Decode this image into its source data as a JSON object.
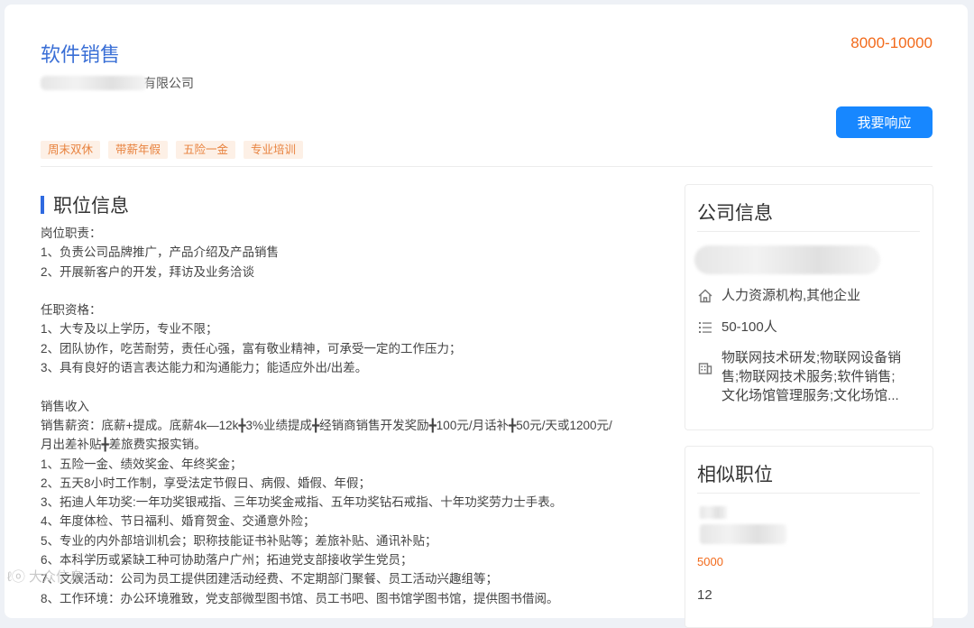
{
  "job": {
    "title": "软件销售",
    "company_suffix": "有限公司",
    "salary": "8000-10000",
    "respond_label": "我要响应",
    "tags": [
      "周末双休",
      "带薪年假",
      "五险一金",
      "专业培训"
    ]
  },
  "section": {
    "title": "职位信息",
    "lines": [
      "岗位职责：",
      "1、负责公司品牌推广，产品介绍及产品销售",
      "2、开展新客户的开发，拜访及业务洽谈",
      "",
      "任职资格：",
      "1、大专及以上学历，专业不限；",
      "2、团队协作，吃苦耐劳，责任心强，富有敬业精神，可承受一定的工作压力；",
      "3、具有良好的语言表达能力和沟通能力；能适应外出/出差。",
      "",
      "销售收入",
      "销售薪资：底薪+提成。底薪4k—12k╋3%业绩提成╋经销商销售开发奖励╋100元/月话补╋50元/天或1200元/",
      "月出差补贴╋差旅费实报实销。",
      "1、五险一金、绩效奖金、年终奖金；",
      "2、五天8小时工作制，享受法定节假日、病假、婚假、年假；",
      "3、拓迪人年功奖:一年功奖银戒指、三年功奖金戒指、五年功奖钻石戒指、十年功奖劳力士手表。",
      "4、年度体检、节日福利、婚育贺金、交通意外险；",
      "5、专业的内外部培训机会；职称技能证书补贴等；差旅补贴、通讯补贴；",
      "6、本科学历或紧缺工种可协助落户广州；拓迪党支部接收学生党员；",
      "7、文娱活动：公司为员工提供团建活动经费、不定期部门聚餐、员工活动兴趣组等；",
      "8、工作环境：办公环境雅致，党支部微型图书馆、员工书吧、图书馆学图书馆，提供图书借阅。"
    ]
  },
  "company_info": {
    "title": "公司信息",
    "type": "人力资源机构,其他企业",
    "size": "50-100人",
    "business": [
      "物联网技术研发;物联网设备销",
      "售;物联网技术服务;软件销售;",
      "文化场馆管理服务;文化场馆..."
    ]
  },
  "similar": {
    "title": "相似职位",
    "salary": "5000",
    "next_partial": "12"
  },
  "watermark": "大众信息"
}
